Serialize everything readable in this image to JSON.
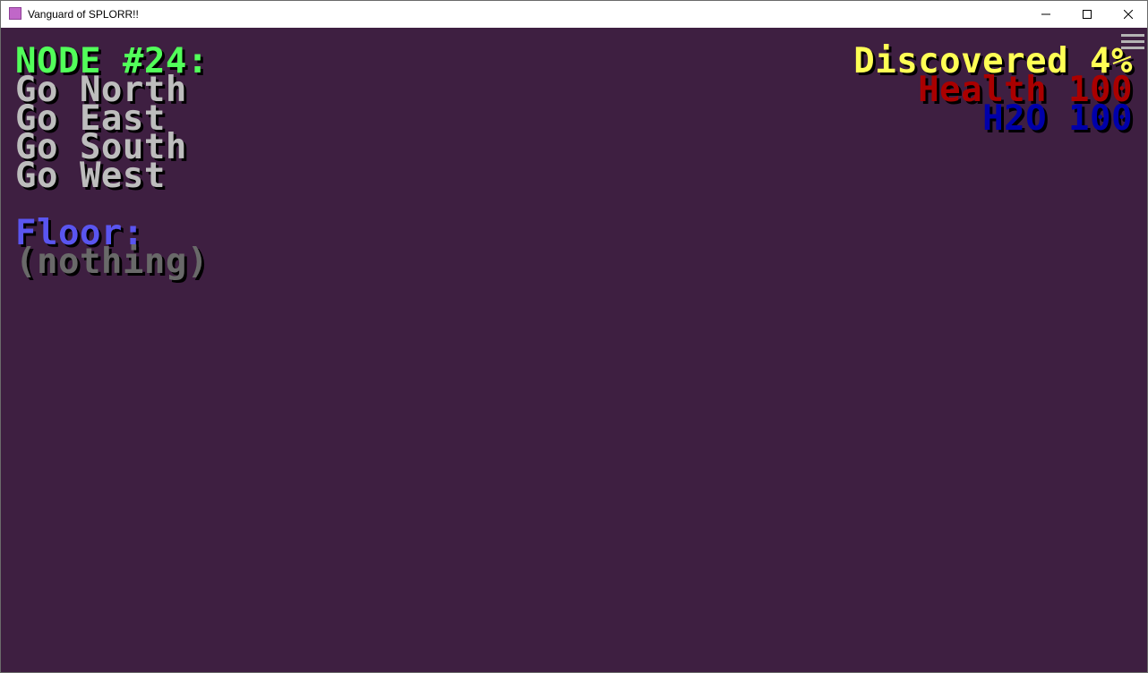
{
  "window": {
    "title": "Vanguard of SPLORR!!"
  },
  "colors": {
    "background": "#3e1f41",
    "node": "#52ff5a",
    "option": "#bdbdbd",
    "floor_label": "#5a55f0",
    "floor_item": "#696969",
    "discovered": "#ffff55",
    "health": "#aa0000",
    "h2o": "#0000aa"
  },
  "game": {
    "node_title": "NODE #24:",
    "options": [
      "Go North",
      "Go East",
      "Go South",
      "Go West"
    ],
    "floor_label": "Floor:",
    "floor_contents": "(nothing)",
    "stats": {
      "discovered": "Discovered 4%",
      "health": "Health 100",
      "h2o": "H2O 100"
    },
    "menu_icon": "hamburger-menu-icon"
  }
}
